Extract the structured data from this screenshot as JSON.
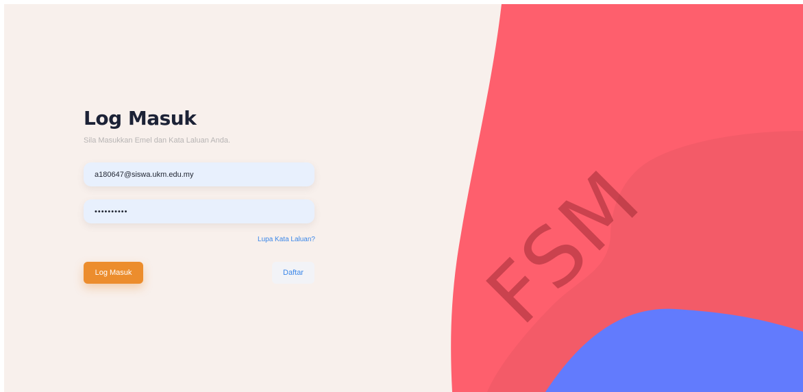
{
  "login": {
    "title": "Log Masuk",
    "subtitle": "Sila Masukkan Emel dan Kata Laluan Anda.",
    "email_value": "a180647@siswa.ukm.edu.my",
    "password_value": "••••••••••",
    "forgot_link": "Lupa Kata Laluan?",
    "login_button": "Log Masuk",
    "register_button": "Daftar"
  },
  "watermark": "FSM",
  "colors": {
    "background": "#f8f0ec",
    "coral_shape": "#fe5f6d",
    "blue_shape": "#627bfd",
    "primary_button": "#ec8d2d",
    "link": "#3a86e8",
    "title": "#1c2236"
  }
}
